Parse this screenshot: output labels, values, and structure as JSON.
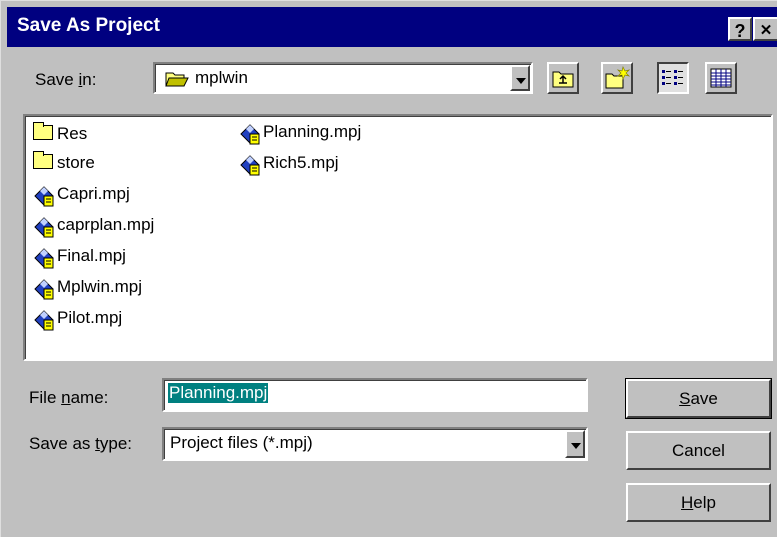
{
  "window": {
    "title": "Save As Project",
    "help_label": "?",
    "close_label": "✕"
  },
  "save_in": {
    "label_pre": "Save ",
    "label_accel": "i",
    "label_post": "n:",
    "value": "mplwin"
  },
  "files": [
    {
      "name": "Res",
      "type": "folder"
    },
    {
      "name": "store",
      "type": "folder"
    },
    {
      "name": "Capri.mpj",
      "type": "project"
    },
    {
      "name": "caprplan.mpj",
      "type": "project"
    },
    {
      "name": "Final.mpj",
      "type": "project"
    },
    {
      "name": "Mplwin.mpj",
      "type": "project"
    },
    {
      "name": "Pilot.mpj",
      "type": "project"
    },
    {
      "name": "Planning.mpj",
      "type": "project"
    },
    {
      "name": "Rich5.mpj",
      "type": "project"
    }
  ],
  "file_name": {
    "label_pre": "File ",
    "label_accel": "n",
    "label_post": "ame:",
    "value": "Planning.mpj"
  },
  "save_as_type": {
    "label_pre": "Save as ",
    "label_accel": "t",
    "label_post": "ype:",
    "value": "Project files (*.mpj)"
  },
  "buttons": {
    "save_accel": "S",
    "save_rest": "ave",
    "cancel": "Cancel",
    "help_accel": "H",
    "help_rest": "elp"
  },
  "colors": {
    "title_bar": "#000080",
    "face": "#c0c0c0",
    "selection": "#008080"
  }
}
